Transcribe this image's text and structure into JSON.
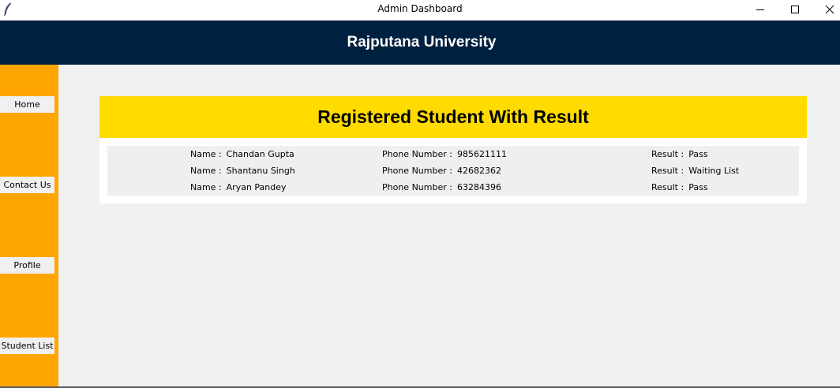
{
  "window": {
    "title": "Admin Dashboard",
    "app_icon": "feather-icon",
    "controls": [
      "minimize-icon",
      "maximize-icon",
      "close-icon"
    ]
  },
  "header": {
    "title": "Rajputana University"
  },
  "sidebar": {
    "items": [
      {
        "label": "Home"
      },
      {
        "label": "Contact Us"
      },
      {
        "label": "Profile"
      },
      {
        "label": "Student List"
      }
    ]
  },
  "main": {
    "heading": "Registered Student With Result",
    "labels": {
      "name": "Name :",
      "phone": "Phone Number :",
      "result": "Result :"
    },
    "students": [
      {
        "name": "Chandan Gupta",
        "phone": "985621111",
        "result": "Pass"
      },
      {
        "name": "Shantanu Singh",
        "phone": "42682362",
        "result": "Waiting List"
      },
      {
        "name": "Aryan Pandey",
        "phone": "63284396",
        "result": "Pass"
      }
    ]
  },
  "colors": {
    "header_bg": "#002040",
    "sidebar_bg": "#ffa500",
    "banner_bg": "#ffdb00",
    "page_bg": "#f0f0f0"
  }
}
